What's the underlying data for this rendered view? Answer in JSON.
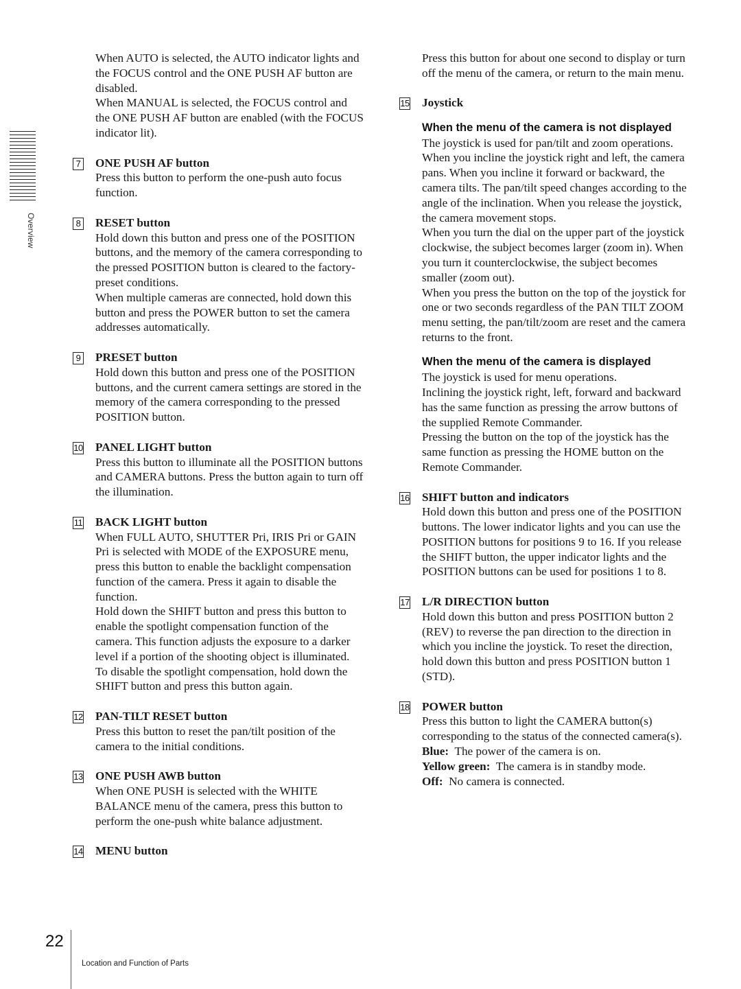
{
  "sidebar": {
    "section_label": "Overview"
  },
  "left_column": {
    "intro": [
      "When AUTO is selected, the AUTO indicator lights and the FOCUS control and the ONE PUSH AF button are disabled.",
      "When MANUAL is selected, the FOCUS control and the ONE PUSH AF button are enabled (with the FOCUS indicator lit)."
    ],
    "items": [
      {
        "number": "7",
        "title": "ONE PUSH AF button",
        "paragraphs": [
          "Press this button to perform the one-push auto focus function."
        ]
      },
      {
        "number": "8",
        "title": "RESET button",
        "paragraphs": [
          "Hold down this button and press one of the POSITION buttons, and the memory of the camera corresponding to the pressed POSITION button is cleared to the factory-preset conditions.",
          "When multiple cameras are connected, hold down this button and press the POWER button to set the camera addresses automatically."
        ]
      },
      {
        "number": "9",
        "title": "PRESET button",
        "paragraphs": [
          "Hold down this button and press one of the POSITION buttons, and the current camera settings are stored in the memory of the camera corresponding to the pressed POSITION button."
        ]
      },
      {
        "number": "10",
        "title": "PANEL LIGHT button",
        "paragraphs": [
          "Press this button to illuminate all the POSITION buttons and CAMERA buttons.  Press the button again to turn off the illumination."
        ]
      },
      {
        "number": "11",
        "title": "BACK LIGHT button",
        "paragraphs": [
          "When FULL AUTO, SHUTTER Pri, IRIS Pri or GAIN Pri is selected with MODE of the EXPOSURE menu, press this button to enable the backlight compensation function of the camera. Press it again to disable the function.",
          "Hold down the SHIFT button and press this button to enable the spotlight compensation function of the camera. This function adjusts the exposure to a darker level if a portion of the shooting object is illuminated.",
          "To disable the spotlight compensation, hold down the SHIFT button and press this button again."
        ]
      },
      {
        "number": "12",
        "title": "PAN-TILT RESET button",
        "paragraphs": [
          "Press this button to reset the pan/tilt position of the camera to the initial conditions."
        ]
      },
      {
        "number": "13",
        "title": "ONE PUSH AWB button",
        "paragraphs": [
          "When ONE PUSH is selected with the WHITE BALANCE menu of the camera, press this button to perform the one-push white balance adjustment."
        ]
      },
      {
        "number": "14",
        "title": "MENU button",
        "paragraphs": []
      }
    ]
  },
  "right_column": {
    "intro": "Press this button for about one second to display or turn off the menu of the camera, or return to the main menu.",
    "joystick": {
      "number": "15",
      "title": "Joystick",
      "not_displayed": {
        "heading": "When the menu of the camera is not displayed",
        "paragraphs": [
          "The joystick is used for pan/tilt and zoom operations.",
          "When you incline the joystick right and left, the camera pans. When you incline it forward or backward, the camera tilts. The pan/tilt speed changes according to the angle of the inclination. When you release the joystick, the camera movement stops.",
          "When you turn the dial on the upper part of the joystick clockwise, the subject becomes larger (zoom in).  When you turn it counterclockwise, the subject becomes smaller (zoom out).",
          "When you press the button on the top of the joystick for one or two seconds regardless of the PAN TILT ZOOM menu setting, the pan/tilt/zoom are reset and the camera returns to the front."
        ]
      },
      "displayed": {
        "heading": "When the menu of the camera is displayed",
        "paragraphs": [
          "The joystick is used for menu operations.",
          "Inclining the joystick right, left, forward and backward has the same function as pressing the arrow buttons of the supplied Remote Commander.",
          "Pressing the button on the top of the joystick has the same function as pressing the HOME button on the Remote Commander."
        ]
      }
    },
    "items": [
      {
        "number": "16",
        "title": "SHIFT button and indicators",
        "paragraphs": [
          "Hold down this button and press one of the POSITION buttons. The lower indicator lights and you can use the POSITION buttons for positions 9 to 16. If you release the SHIFT button, the upper indicator lights and the POSITION buttons can be used for positions 1 to 8."
        ]
      },
      {
        "number": "17",
        "title": "L/R DIRECTION button",
        "paragraphs": [
          "Hold down this button and press POSITION button 2 (REV) to reverse the pan direction to the direction in which you incline the joystick.  To reset the direction, hold down this button and press POSITION button 1 (STD)."
        ]
      }
    ],
    "power": {
      "number": "18",
      "title": "POWER button",
      "description": "Press this button to light the CAMERA button(s) corresponding to the status of the connected camera(s).",
      "states": [
        {
          "label": "Blue:",
          "text": "The power of the camera is on."
        },
        {
          "label": "Yellow green:",
          "text": "The camera is in standby mode."
        },
        {
          "label": "Off:",
          "text": "No camera is connected."
        }
      ]
    }
  },
  "footer": {
    "page_number": "22",
    "section_title": "Location and Function of Parts"
  }
}
